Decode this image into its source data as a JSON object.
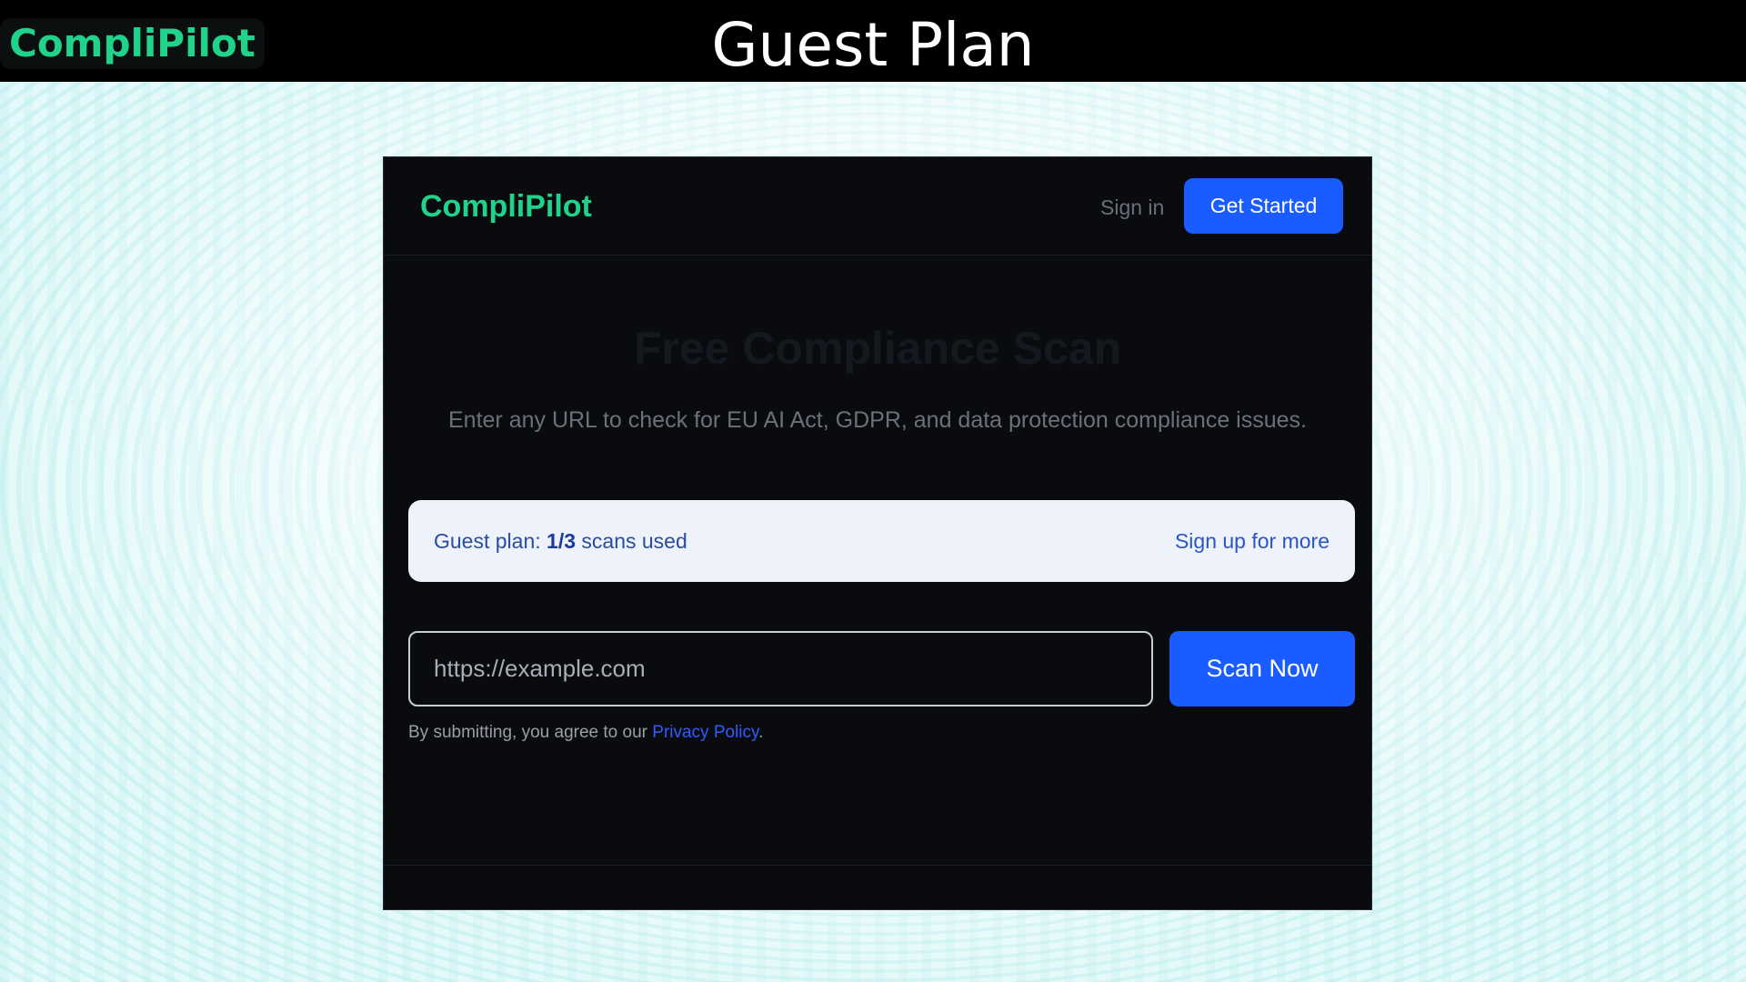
{
  "slide": {
    "logo": "CompliPilot",
    "title": "Guest Plan"
  },
  "app": {
    "logo": "CompliPilot",
    "nav": {
      "sign_in": "Sign in",
      "get_started": "Get Started"
    },
    "hero": {
      "title": "Free Compliance Scan",
      "subtitle": "Enter any URL to check for EU AI Act, GDPR, and data protection compliance issues."
    },
    "plan_banner": {
      "prefix": "Guest plan: ",
      "usage": "1/3",
      "suffix": " scans used",
      "link": "Sign up for more"
    },
    "scan_form": {
      "url_placeholder": "https://example.com",
      "url_value": "",
      "submit_label": "Scan Now",
      "agreement_prefix": "By submitting, you agree to our ",
      "agreement_link": "Privacy Policy",
      "agreement_suffix": "."
    }
  },
  "colors": {
    "brand_green": "#1fd38a",
    "primary_blue": "#1a5cff",
    "app_background": "#0a0b0f",
    "banner_background": "#eef3fb"
  }
}
